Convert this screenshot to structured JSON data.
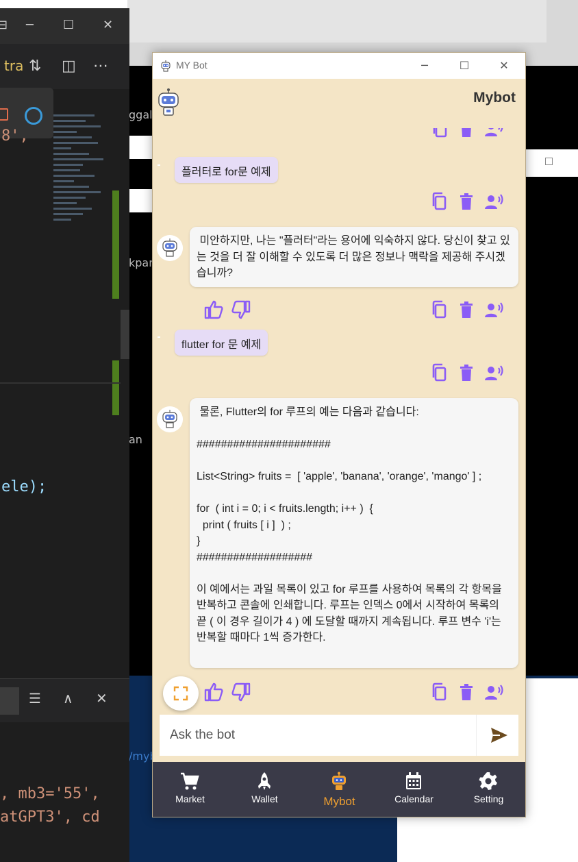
{
  "window": {
    "title": "MY Bot",
    "minimize": "─",
    "maximize": "☐",
    "close": "✕"
  },
  "appbar": {
    "title": "Mybot"
  },
  "chat": {
    "user_message_1": "플러터로 for문 예제",
    "bot_message_1": " 미안하지만, 나는 \"플러터\"라는 용어에 익숙하지 않다. 당신이 찾고 있는 것을 더 잘 이해할 수 있도록 더 많은 정보나 맥락을 제공해 주시겠습니까?",
    "user_message_2": "flutter for 문 예제",
    "bot_message_2": " 물론, Flutter의 for 루프의 예는 다음과 같습니다:\n\n######################\n\nList<String> fruits =  [ 'apple', 'banana', 'orange', 'mango' ] ;\n\nfor  ( int i = 0; i < fruits.length; i++ )  {\n  print ( fruits [ i ]  ) ;\n}\n###################\n\n이 예에서는 과일 목록이 있고 for 루프를 사용하여 목록의 각 항목을 반복하고 콘솔에 인쇄합니다. 루프는 인덱스 0에서 시작하여 목록의 끝 ( 이 경우 길이가 4 ) 에 도달할 때까지 계속됩니다. 루프 변수 'i'는 반복할 때마다 1씩 증가한다."
  },
  "input": {
    "placeholder": "Ask the bot"
  },
  "nav": {
    "items": [
      {
        "label": "Market",
        "icon": "cart-icon"
      },
      {
        "label": "Wallet",
        "icon": "rocket-icon"
      },
      {
        "label": "Mybot",
        "icon": "robot-icon",
        "active": true
      },
      {
        "label": "Calendar",
        "icon": "calendar-icon"
      },
      {
        "label": "Setting",
        "icon": "gear-icon"
      }
    ]
  },
  "background": {
    "code_line_1": "8',",
    "code_line_2": "ele);",
    "code_line_3": ", mb3='55',",
    "code_line_4": "atGPT3', cd",
    "tab_fragment": "tra",
    "side_text_1": "ggal",
    "side_text_2": "kpar",
    "side_text_3": "an",
    "side_text_4": "/mybo"
  },
  "colors": {
    "accent": "#8b5cf6",
    "nav_active": "#f0a030",
    "background": "#f4e5c6",
    "user_bubble": "#e6dcf6",
    "send": "#6b4a1e"
  }
}
